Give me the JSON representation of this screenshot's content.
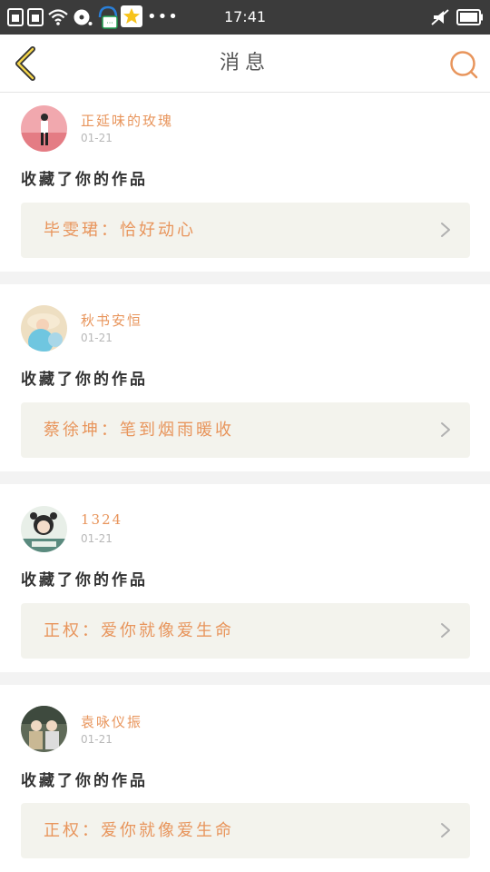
{
  "status_bar": {
    "time": "17:41",
    "left_icons": [
      "sim-icon",
      "sim-icon",
      "wifi-icon",
      "disc-icon",
      "headset-app-icon",
      "star-app-icon"
    ],
    "right_icons": [
      "mute-icon",
      "battery-icon"
    ]
  },
  "header": {
    "title": "消息",
    "accent_color": "#e8955c"
  },
  "feed": [
    {
      "username": "正延味的玫瑰",
      "date": "01-21",
      "action": "收藏了你的作品",
      "work_title": "毕雯珺：恰好动心",
      "avatar_colors": [
        "#f1a8ae",
        "#e47c84"
      ]
    },
    {
      "username": "秋书安恒",
      "date": "01-21",
      "action": "收藏了你的作品",
      "work_title": "蔡徐坤：笔到烟雨暖收",
      "avatar_colors": [
        "#a9d7e8",
        "#f2e2c6"
      ]
    },
    {
      "username": "1324",
      "date": "01-21",
      "action": "收藏了你的作品",
      "work_title": "正权：爱你就像爱生命",
      "avatar_colors": [
        "#e8efe8",
        "#5a8a7e"
      ]
    },
    {
      "username": "袁咏仪振",
      "date": "01-21",
      "action": "收藏了你的作品",
      "work_title": "正权：爱你就像爱生命",
      "avatar_colors": [
        "#5f6a58",
        "#c9b894"
      ]
    }
  ]
}
